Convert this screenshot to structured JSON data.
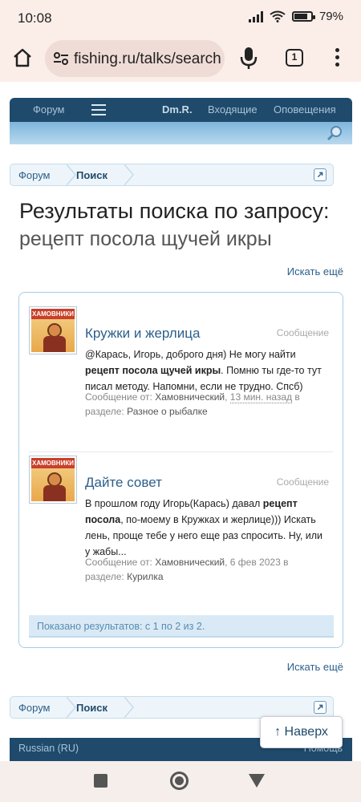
{
  "status": {
    "time": "10:08",
    "battery": "79%"
  },
  "browser": {
    "url": "fishing.ru/talks/search",
    "tab_count": "1"
  },
  "forum_nav": {
    "forum": "Форум",
    "user": "Dm.R.",
    "inbox": "Входящие",
    "alerts": "Оповещения"
  },
  "breadcrumb": {
    "forum": "Форум",
    "search": "Поиск"
  },
  "page": {
    "title": "Результаты поиска по запросу:",
    "query": "рецепт посола щучей икры",
    "search_more": "Искать ещё"
  },
  "results": [
    {
      "title": "Кружки и жерлица",
      "type": "Сообщение",
      "snippet_pre": "@Карась, Игорь, доброго дня) Не могу найти ",
      "snippet_bold": "рецепт посола щучей икры",
      "snippet_post": ". Помню ты где-то тут писал методу. Напомни, если не трудно. Спсб)",
      "meta_label": "Сообщение от:",
      "author": "Хамовнический",
      "time": "13 мин. назад",
      "section_label": "в разделе:",
      "section": "Разное о рыбалке"
    },
    {
      "title": "Дайте совет",
      "type": "Сообщение",
      "snippet_pre": "В прошлом году Игорь(Карась) давал ",
      "snippet_bold": "рецепт посола",
      "snippet_post": ", по-моему в Кружках и жерлице))) Искать лень, проще тебе у него еще раз спросить. Ну, или у жабы...",
      "meta_label": "Сообщение от:",
      "author": "Хамовнический",
      "time": "6 фев 2023",
      "section_label": "в разделе:",
      "section": "Курилка"
    }
  ],
  "avatar_text": "ХАМОВНИКИ",
  "shown_text": "Показано результатов: с 1 по 2 из 2.",
  "footer": {
    "lang": "Russian (RU)",
    "help": "Помощь"
  },
  "to_top": "↑ Наверх"
}
